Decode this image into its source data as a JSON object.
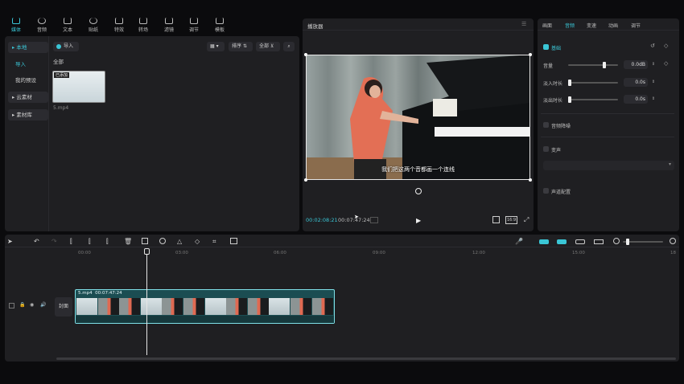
{
  "toolbar": {
    "items": [
      {
        "label": "媒体",
        "icon": "media-icon",
        "active": true
      },
      {
        "label": "音频",
        "icon": "audio-icon"
      },
      {
        "label": "文本",
        "icon": "text-icon"
      },
      {
        "label": "贴纸",
        "icon": "sticker-icon"
      },
      {
        "label": "特效",
        "icon": "effects-icon"
      },
      {
        "label": "转场",
        "icon": "transition-icon"
      },
      {
        "label": "滤镜",
        "icon": "filter-icon"
      },
      {
        "label": "调节",
        "icon": "adjust-icon"
      },
      {
        "label": "模板",
        "icon": "template-icon"
      }
    ]
  },
  "sidebar": {
    "items": [
      {
        "label": "▸ 本地",
        "selected": true
      },
      {
        "label": "导入",
        "accent": true
      },
      {
        "label": "我的预设"
      },
      {
        "label": "▸ 云素材"
      },
      {
        "label": "▸ 素材库"
      }
    ]
  },
  "media": {
    "import_label": "导入",
    "sort_label": "排序",
    "all_label": "全部",
    "filter_label": "全部",
    "clip": {
      "badge": "已添加",
      "filename": "5.mp4"
    }
  },
  "player": {
    "title": "播放器",
    "subtitle": "我们把这两个音都画一个连线",
    "current_time": "00:02:08:21",
    "total_time": "00:07:47:24",
    "ratio_label": "16:9"
  },
  "inspector": {
    "tabs": [
      "画面",
      "音频",
      "变速",
      "动画",
      "调节"
    ],
    "active_tab": "音频",
    "basic_label": "基础",
    "volume_label": "音量",
    "volume_value": "0.0dB",
    "volume_level": 0.72,
    "fadein_label": "淡入时长",
    "fadein_value": "0.0s",
    "fadeout_label": "淡出时长",
    "fadeout_value": "0.0s",
    "denoise_label": "音频降噪",
    "voice_label": "变声",
    "channel_label": "声道配置"
  },
  "timeline": {
    "ticks": [
      "00:00",
      "03:00",
      "06:00",
      "09:00",
      "12:00",
      "15:00",
      "18"
    ],
    "clip_name": "5.mp4",
    "clip_duration": "00:07:47:24",
    "cover_label": "封面"
  },
  "colors": {
    "accent": "#3ac6d6",
    "panel": "#1f1f22",
    "background": "#0b0b0d"
  }
}
